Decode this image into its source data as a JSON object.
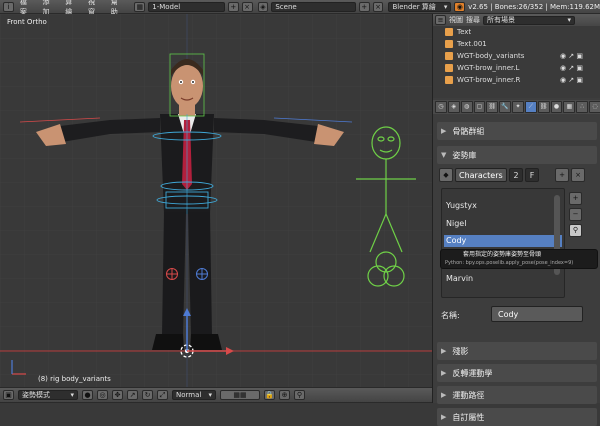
{
  "topbar": {
    "menus": [
      "檔案",
      "添加",
      "算繪",
      "視窗",
      "幫助"
    ],
    "screen_layout": "1-Model",
    "scene": "Scene",
    "render_engine": "Blender 算繪",
    "stats": "v2.65 | Bones:26/352 | Mem:119.62M"
  },
  "viewport": {
    "view_label": "Front Ortho",
    "object_label": "(8) rig body_variants"
  },
  "bottombar": {
    "mode": "姿勢模式",
    "pivot": "Normal"
  },
  "outliner": {
    "scene_select": "所有場景",
    "rows": [
      "Text",
      "Text.001",
      "WGT-body_variants",
      "WGT-brow_inner.L",
      "WGT-brow_inner.R"
    ]
  },
  "properties": {
    "sections": {
      "bone_groups": "骨骼群組",
      "pose_library": "姿勢庫",
      "ghost": "殘影",
      "ik": "反轉運動學",
      "motion_paths": "運動路徑",
      "custom_props": "自訂屬性"
    },
    "library": {
      "name": "Characters",
      "users": "2",
      "fake_user": "F"
    },
    "poses": [
      "Yugstyx",
      "Nigel",
      "Cody",
      "Marvin"
    ],
    "selected_pose": "Cody",
    "name_label": "名稱:",
    "name_value": "Cody",
    "tooltip": {
      "text": "套用指定的姿勢庫姿勢至骨頭",
      "python": "Python: bpy.ops.poselib.apply_pose(pose_index=9)"
    }
  },
  "colors": {
    "accent": "#5680c2",
    "axis_x": "#d84a4a",
    "axis_z": "#4e7bd4",
    "bone_widget": "#6fd047"
  }
}
